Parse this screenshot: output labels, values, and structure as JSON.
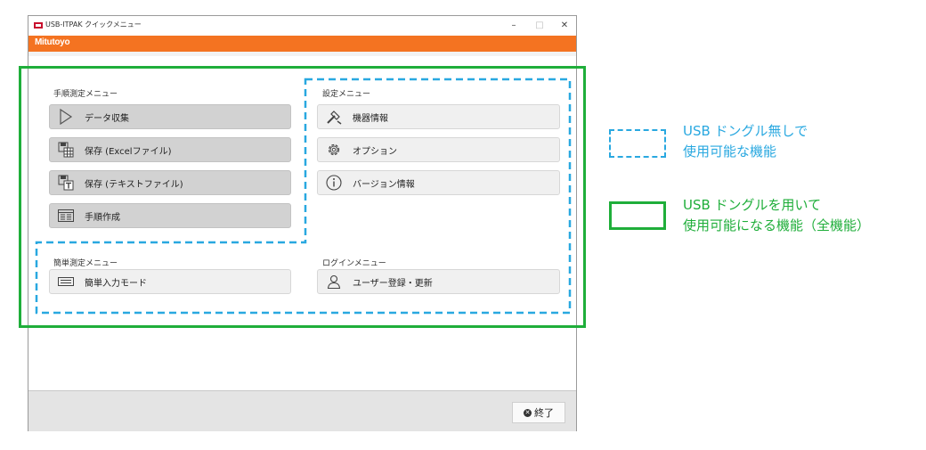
{
  "window": {
    "title": "USB-ITPAK クイックメニュー",
    "minimize": "–",
    "maximize": "□",
    "close": "✕",
    "brand": "Mitutoyo"
  },
  "manual_menu": {
    "label": "手順測定メニュー",
    "items": [
      {
        "label": "データ収集",
        "icon": "play-icon"
      },
      {
        "label": "保存 (Excelファイル)",
        "icon": "save-excel-icon"
      },
      {
        "label": "保存 (テキストファイル)",
        "icon": "save-text-icon"
      },
      {
        "label": "手順作成",
        "icon": "procedure-icon"
      }
    ]
  },
  "settings_menu": {
    "label": "設定メニュー",
    "items": [
      {
        "label": "機器情報",
        "icon": "tools-icon"
      },
      {
        "label": "オプション",
        "icon": "gear-icon"
      },
      {
        "label": "バージョン情報",
        "icon": "info-icon"
      }
    ]
  },
  "simple_menu": {
    "label": "簡単測定メニュー",
    "items": [
      {
        "label": "簡単入力モード",
        "icon": "keyboard-icon"
      }
    ]
  },
  "login_menu": {
    "label": "ログインメニュー",
    "items": [
      {
        "label": "ユーザー登録・更新",
        "icon": "user-icon"
      }
    ]
  },
  "footer": {
    "exit_label": "終了",
    "exit_icon": "close-circle-icon"
  },
  "legend": {
    "dongle_free": {
      "line1": "USB ドングル無しで",
      "line2": "使用可能な機能",
      "color": "#29a8e0"
    },
    "dongle_required": {
      "line1": "USB ドングルを用いて",
      "line2": "使用可能になる機能（全機能）",
      "color": "#1fae3a"
    }
  },
  "colors": {
    "brand_bar": "#f47321",
    "dashed_frame": "#29a8e0",
    "solid_frame": "#1fae3a"
  }
}
